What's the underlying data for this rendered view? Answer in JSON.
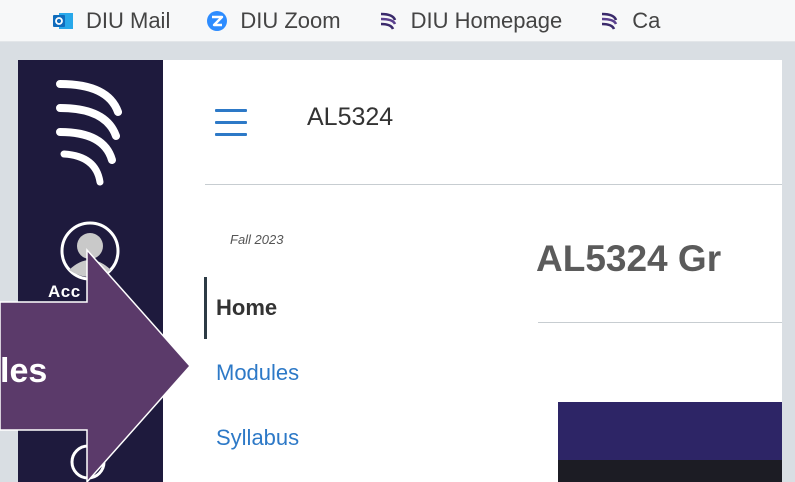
{
  "bookmarks": [
    {
      "label": "DIU Mail",
      "icon": "outlook-icon",
      "color": "#0f6cbd"
    },
    {
      "label": "DIU Zoom",
      "icon": "zoom-icon",
      "color": "#2d8cff"
    },
    {
      "label": "DIU Homepage",
      "icon": "diu-logo-icon",
      "color": "#3a2a6b"
    },
    {
      "label": "Ca",
      "icon": "diu-logo-icon",
      "color": "#3a2a6b"
    }
  ],
  "global_nav": {
    "account_label": "Acc",
    "background": "#1e1a3d"
  },
  "course_header": {
    "code": "AL5324"
  },
  "course_nav": {
    "term": "Fall 2023",
    "items": [
      {
        "label": "Home",
        "active": true
      },
      {
        "label": "Modules",
        "active": false
      },
      {
        "label": "Syllabus",
        "active": false
      }
    ]
  },
  "main": {
    "page_title": "AL5324 Gr"
  },
  "callout": {
    "label": "les",
    "color": "#5b3a6a"
  },
  "colors": {
    "link": "#2d79c7",
    "banner": "#2d2566"
  }
}
